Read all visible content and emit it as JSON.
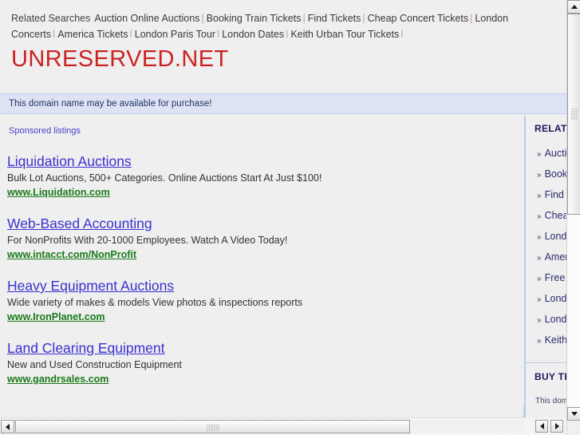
{
  "related_searches": {
    "heading": "Related Searches",
    "separator": "|",
    "items": [
      "Auction Online Auctions",
      "Booking Train Tickets",
      "Find Tickets",
      "Cheap Concert Tickets",
      "London Concerts",
      "America Tickets",
      "London Paris Tour",
      "London Dates",
      "Keith Urban Tour Tickets"
    ]
  },
  "domain": {
    "title": "UNRESERVED.NET",
    "title_color": "#cc2222"
  },
  "purchase_banner": {
    "text": "This domain name may be available for purchase!",
    "background": "#dde3f3",
    "text_color": "#223366"
  },
  "main": {
    "sponsored_label": "Sponsored listings",
    "ads": [
      {
        "title": "Liquidation Auctions",
        "description": "Bulk Lot Auctions, 500+ Categories. Online Auctions Start At Just $100!",
        "url": "www.Liquidation.com"
      },
      {
        "title": "Web-Based Accounting",
        "description": "For NonProfits With 20-1000 Employees. Watch A Video Today!",
        "url": "www.intacct.com/NonProfit"
      },
      {
        "title": "Heavy Equipment Auctions",
        "description": "Wide variety of makes & models View photos & inspections reports",
        "url": "www.IronPlanet.com"
      },
      {
        "title": "Land Clearing Equipment",
        "description": "New and Used Construction Equipment",
        "url": "www.gandrsales.com"
      }
    ],
    "link_color": "#3a31cf",
    "url_color": "#1a7a1a"
  },
  "sidebar": {
    "related_heading": "RELATED SEARCHES",
    "bullet": "»",
    "related_items": [
      "Auction Online Auctions",
      "Booking Train Tickets",
      "Find Tickets",
      "Cheap Concert Tickets",
      "London Concerts",
      "America Tickets",
      "Free Tickets",
      "London Paris Tour",
      "London Dates",
      "Keith Urban Tour Tickets"
    ],
    "buy_heading": "BUY THIS DOMAIN",
    "buy_text": "This domain name may be for sale"
  },
  "scrollbars": {
    "outer_vertical": {
      "up_arrow": "▲",
      "down_arrow": "▼"
    },
    "inner_horizontal": {
      "left_arrow": "◄",
      "right_arrow": "►"
    },
    "sidebar_horizontal": {
      "left_arrow": "◄",
      "right_arrow": "►"
    }
  }
}
